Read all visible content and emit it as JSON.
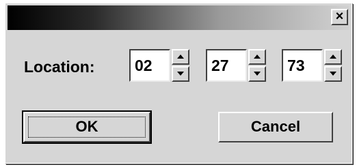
{
  "dialog": {
    "close_glyph": "×",
    "location_label": "Location:",
    "fields": [
      {
        "value": "02"
      },
      {
        "value": "27"
      },
      {
        "value": "73"
      }
    ],
    "ok_label": "OK",
    "cancel_label": "Cancel"
  },
  "icons": {
    "close": "close-icon",
    "spin_up": "arrow-up-icon",
    "spin_down": "arrow-down-icon"
  }
}
